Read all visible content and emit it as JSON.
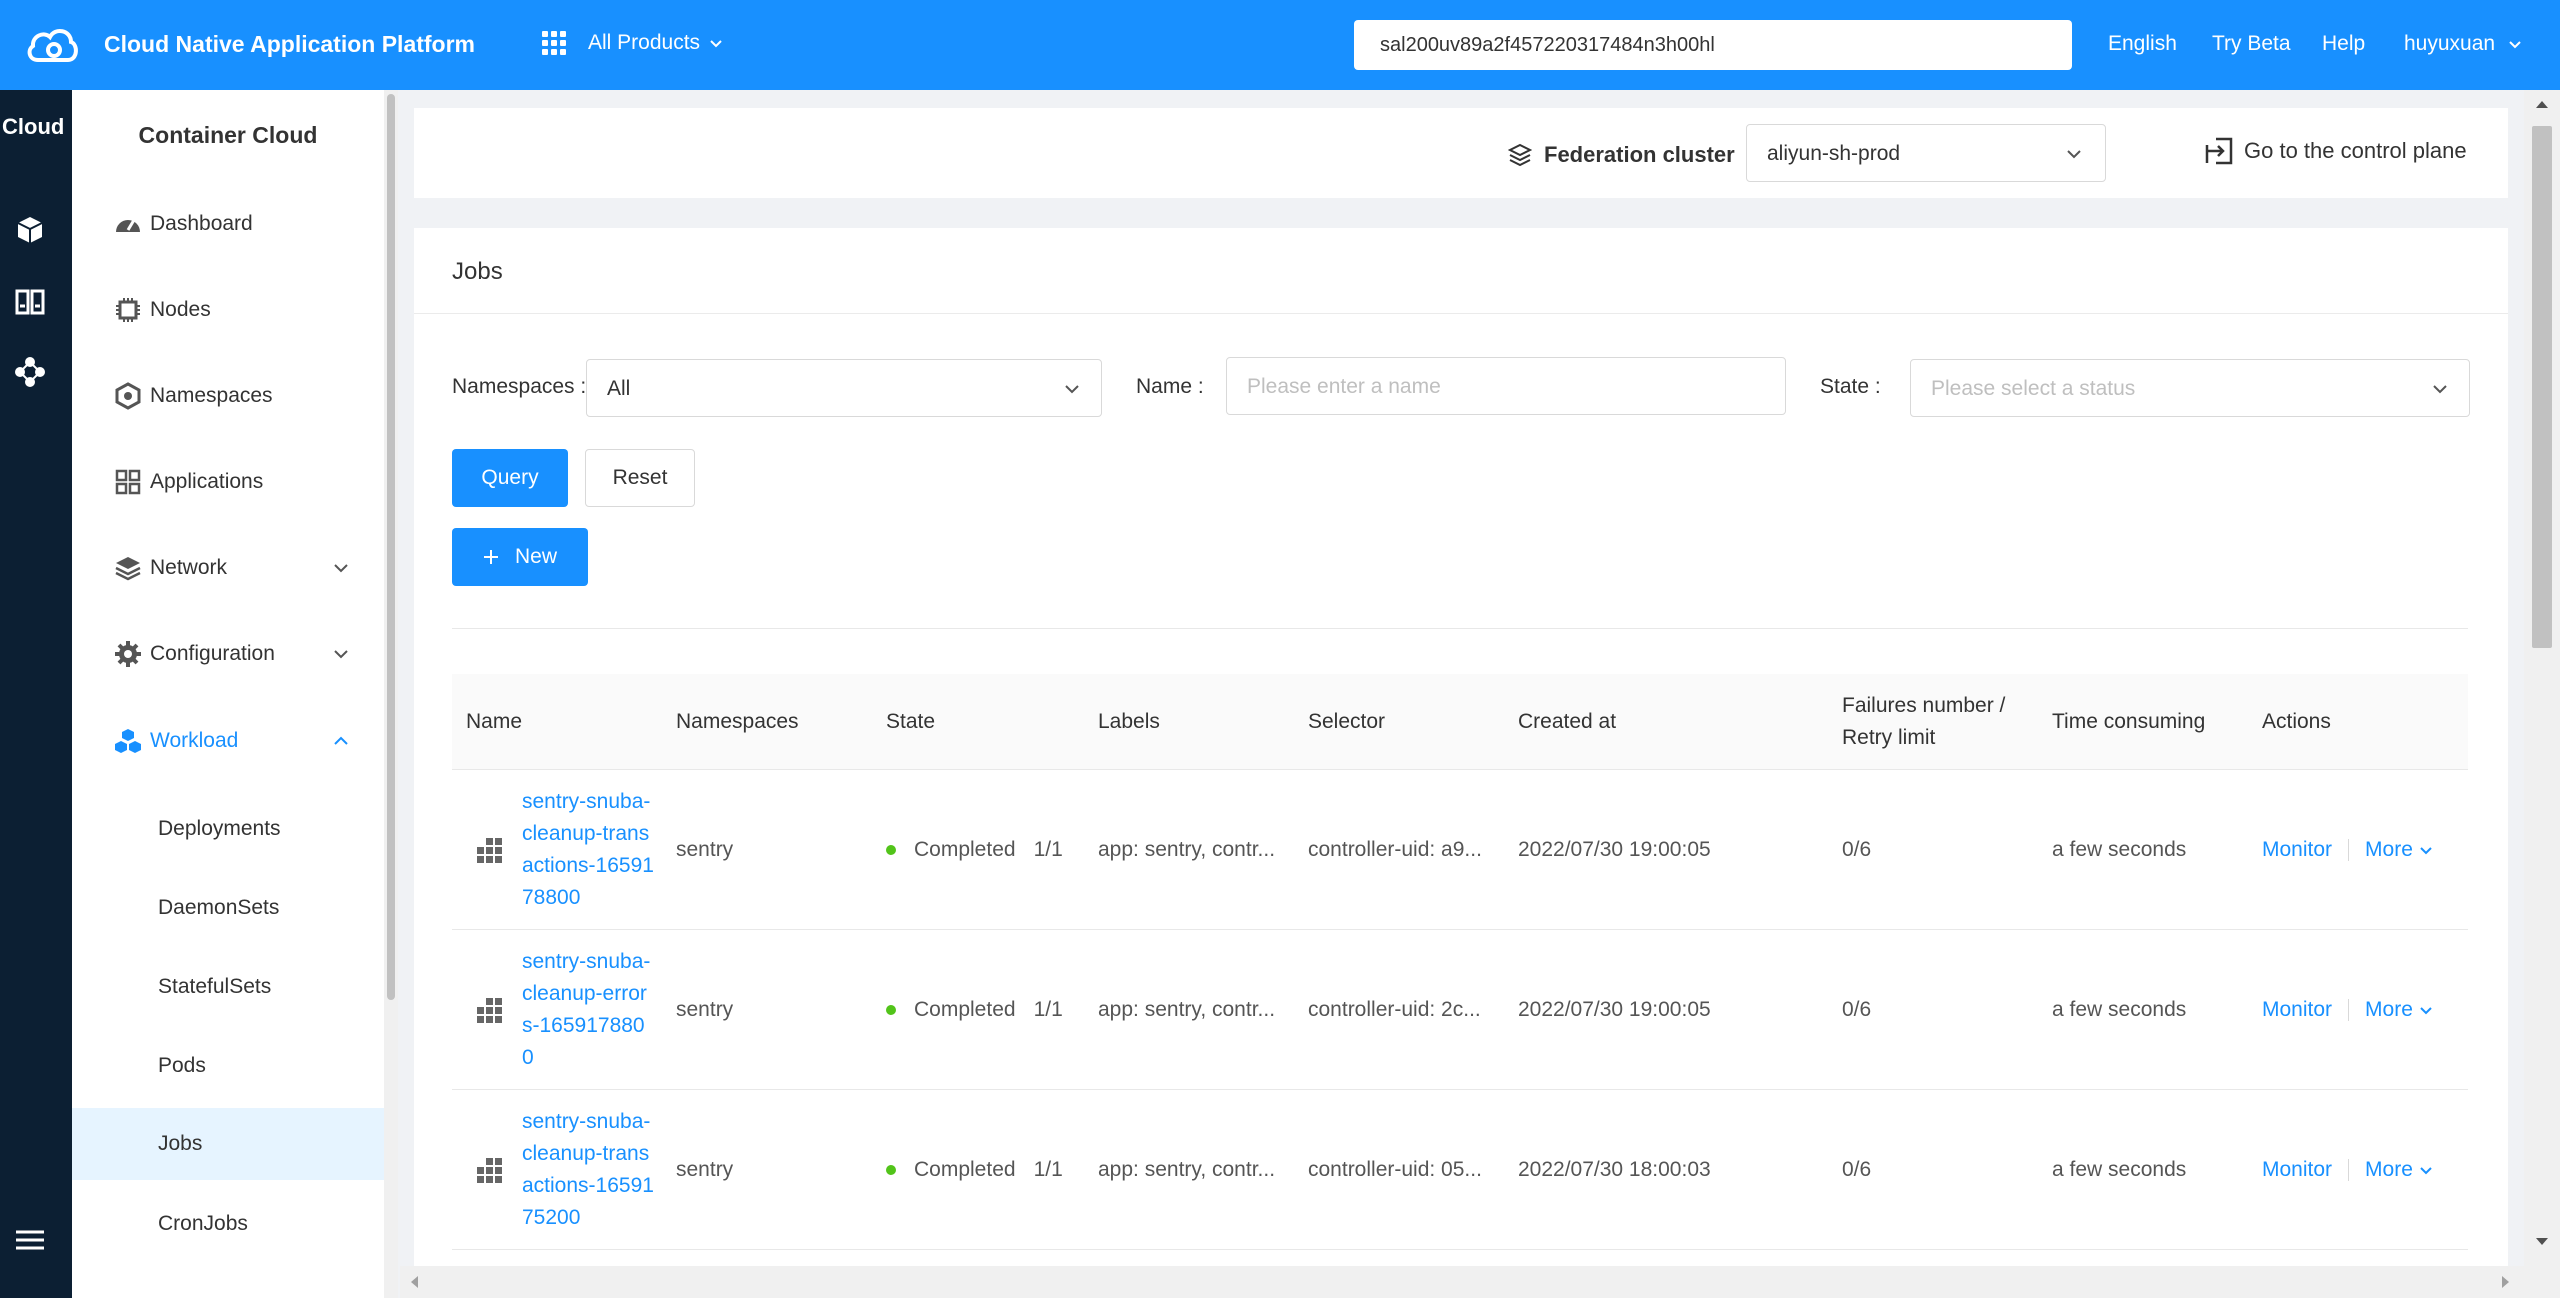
{
  "topbar": {
    "title": "Cloud Native Application Platform",
    "products_label": "All Products",
    "search_value": "sal200uv89a2f457220317484n3h00hl",
    "language": "English",
    "try_beta": "Try Beta",
    "help": "Help",
    "user": "huyuxuan"
  },
  "rail": {
    "title": "Cloud"
  },
  "sidebar": {
    "title": "Container Cloud",
    "items": [
      {
        "label": "Dashboard",
        "icon": "dashboard-icon"
      },
      {
        "label": "Nodes",
        "icon": "chip-icon"
      },
      {
        "label": "Namespaces",
        "icon": "hexagon-icon"
      },
      {
        "label": "Applications",
        "icon": "apps-grid-icon"
      },
      {
        "label": "Network",
        "icon": "layers-icon"
      },
      {
        "label": "Configuration",
        "icon": "gear-icon"
      },
      {
        "label": "Workload",
        "icon": "cubes-icon"
      }
    ],
    "workload_children": [
      "Deployments",
      "DaemonSets",
      "StatefulSets",
      "Pods",
      "Jobs",
      "CronJobs"
    ],
    "active": "Jobs"
  },
  "federation": {
    "label": "Federation cluster",
    "cluster": "aliyun-sh-prod",
    "go_control_plane": "Go to the control plane"
  },
  "page": {
    "title": "Jobs",
    "filters": {
      "namespaces_label": "Namespaces :",
      "namespaces_value": "All",
      "name_label": "Name :",
      "name_placeholder": "Please enter a name",
      "state_label": "State :",
      "state_placeholder": "Please select a status"
    },
    "query_label": "Query",
    "reset_label": "Reset",
    "new_label": "New"
  },
  "table": {
    "headers": [
      "Name",
      "Namespaces",
      "State",
      "Labels",
      "Selector",
      "Created at",
      "Failures number / Retry limit",
      "Time consuming",
      "Actions"
    ],
    "rows": [
      {
        "name": "sentry-snuba-cleanup-transactions-1659178800",
        "namespace": "sentry",
        "state": "Completed",
        "count": "1/1",
        "labels": "app: sentry, contr...",
        "selector": "controller-uid: a9...",
        "created": "2022/07/30 19:00:05",
        "failures": "0/6",
        "time": "a few seconds",
        "monitor": "Monitor",
        "more": "More"
      },
      {
        "name": "sentry-snuba-cleanup-errors-1659178800",
        "namespace": "sentry",
        "state": "Completed",
        "count": "1/1",
        "labels": "app: sentry, contr...",
        "selector": "controller-uid: 2c...",
        "created": "2022/07/30 19:00:05",
        "failures": "0/6",
        "time": "a few seconds",
        "monitor": "Monitor",
        "more": "More"
      },
      {
        "name": "sentry-snuba-cleanup-transactions-1659175200",
        "namespace": "sentry",
        "state": "Completed",
        "count": "1/1",
        "labels": "app: sentry, contr...",
        "selector": "controller-uid: 05...",
        "created": "2022/07/30 18:00:03",
        "failures": "0/6",
        "time": "a few seconds",
        "monitor": "Monitor",
        "more": "More"
      }
    ]
  },
  "colors": {
    "primary": "#1890ff",
    "rail": "#0c1f33",
    "success": "#52c41a"
  }
}
